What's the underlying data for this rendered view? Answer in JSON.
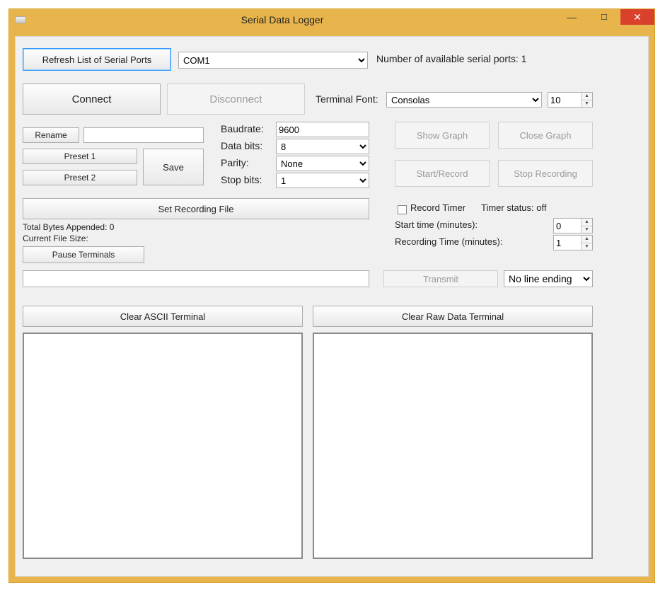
{
  "window": {
    "title": "Serial Data Logger"
  },
  "toolbar": {
    "refresh_label": "Refresh List of Serial Ports",
    "port_selected": "COM1",
    "ports_count_label": "Number of available serial ports: 1"
  },
  "connection": {
    "connect_label": "Connect",
    "disconnect_label": "Disconnect"
  },
  "terminal_font": {
    "label": "Terminal Font:",
    "font": "Consolas",
    "size": "10"
  },
  "preset": {
    "rename_label": "Rename",
    "rename_value": "",
    "preset1_label": "Preset 1",
    "preset2_label": "Preset 2",
    "save_label": "Save"
  },
  "serial": {
    "baudrate_label": "Baudrate:",
    "baudrate_value": "9600",
    "databits_label": "Data bits:",
    "databits_value": "8",
    "parity_label": "Parity:",
    "parity_value": "None",
    "stopbits_label": "Stop bits:",
    "stopbits_value": "1"
  },
  "graph": {
    "show_label": "Show Graph",
    "close_label": "Close Graph",
    "start_label": "Start/Record",
    "stop_label": "Stop Recording"
  },
  "recording": {
    "set_file_label": "Set Recording File",
    "bytes_label": "Total Bytes Appended: 0",
    "filesize_label": "Current File Size:",
    "pause_label": "Pause Terminals"
  },
  "timer": {
    "record_timer_label": "Record Timer",
    "status_label": "Timer status: off",
    "start_time_label": "Start time (minutes):",
    "start_time_value": "0",
    "rec_time_label": "Recording Time (minutes):",
    "rec_time_value": "1"
  },
  "transmit": {
    "input_value": "",
    "button_label": "Transmit",
    "line_ending": "No line ending"
  },
  "terminals": {
    "clear_ascii_label": "Clear ASCII Terminal",
    "clear_raw_label": "Clear Raw Data Terminal"
  }
}
